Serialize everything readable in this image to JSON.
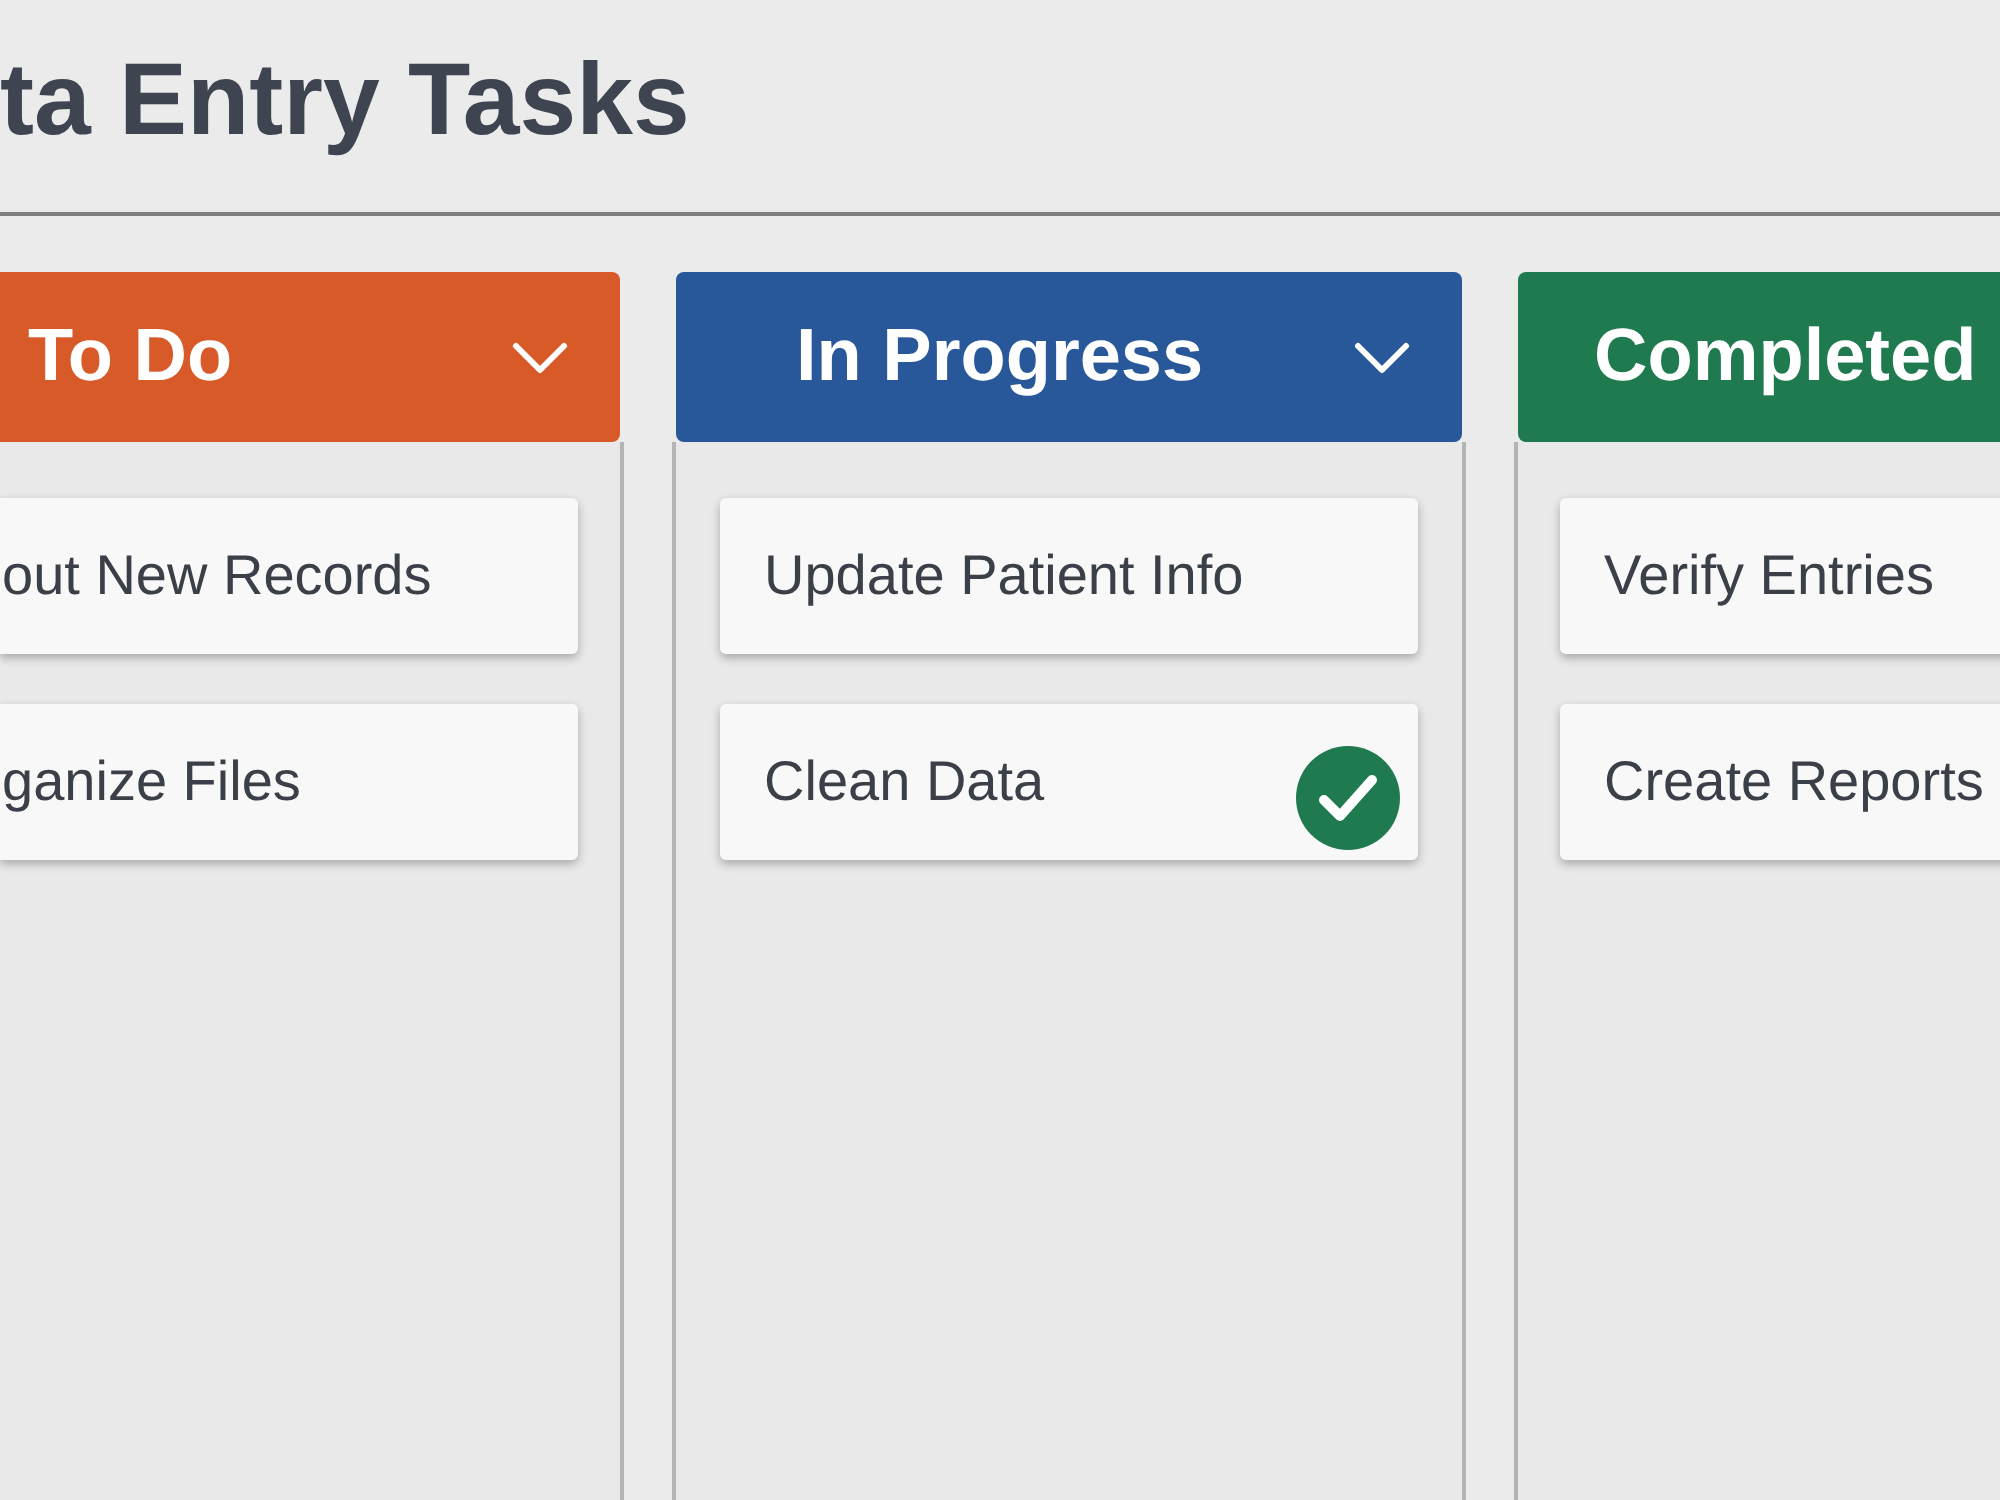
{
  "board": {
    "title": "ta Entry Tasks"
  },
  "columns": [
    {
      "title": "To Do",
      "color": "#d85a28",
      "dropdown": true,
      "cards": [
        {
          "title": "out New Records",
          "done": false
        },
        {
          "title": "ganize Files",
          "done": false
        }
      ]
    },
    {
      "title": "In Progress",
      "color": "#28579a",
      "dropdown": true,
      "cards": [
        {
          "title": "Update Patient Info",
          "done": false
        },
        {
          "title": "Clean Data",
          "done": true
        }
      ]
    },
    {
      "title": "Completed",
      "color": "#1f7a50",
      "dropdown": false,
      "cards": [
        {
          "title": "Verify Entries",
          "done": false
        },
        {
          "title": "Create Reports",
          "done": false
        }
      ]
    }
  ]
}
